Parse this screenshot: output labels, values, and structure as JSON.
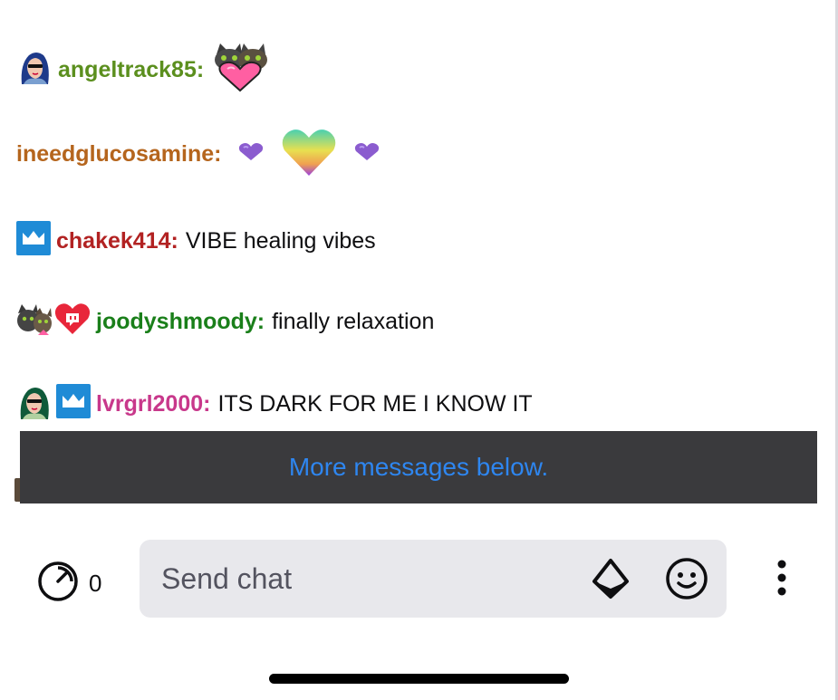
{
  "chat": {
    "messages": [
      {
        "username": "angeltrack85:",
        "username_color": "#5b8f1e",
        "text": "",
        "badges": [
          "avatar-badge"
        ],
        "emotes": [
          "cats-heart-emote"
        ]
      },
      {
        "username": "ineedglucosamine:",
        "username_color": "#b5651d",
        "text": "",
        "badges": [],
        "emotes": [
          "purple-heart-emote",
          "rainbow-heart-emote",
          "purple-heart-emote"
        ]
      },
      {
        "username": "chakek414:",
        "username_color": "#b22222",
        "text": "VIBE healing vibes",
        "badges": [
          "subscriber-crown-badge"
        ],
        "emotes": []
      },
      {
        "username": "joodyshmoody:",
        "username_color": "#1a7f1a",
        "text": "finally relaxation",
        "badges": [
          "cats-badge",
          "heart-badge"
        ],
        "emotes": []
      },
      {
        "username": "lvrgrl2000:",
        "username_color": "#c8388b",
        "text": "ITS DARK FOR ME I KNOW IT",
        "badges": [
          "avatar-badge",
          "subscriber-crown-badge"
        ],
        "emotes": []
      }
    ],
    "more_messages_label": "More messages below."
  },
  "composer": {
    "points_count": "0",
    "placeholder": "Send chat",
    "bits_icon": "bits-icon",
    "emote_icon": "emote-picker-icon",
    "more_icon": "vertical-more-icon"
  },
  "colors": {
    "banner_bg": "#3a3a3d",
    "banner_text": "#2e86f0",
    "input_bg": "#e8e8ec",
    "badge_blue": "#1f8bd6"
  }
}
